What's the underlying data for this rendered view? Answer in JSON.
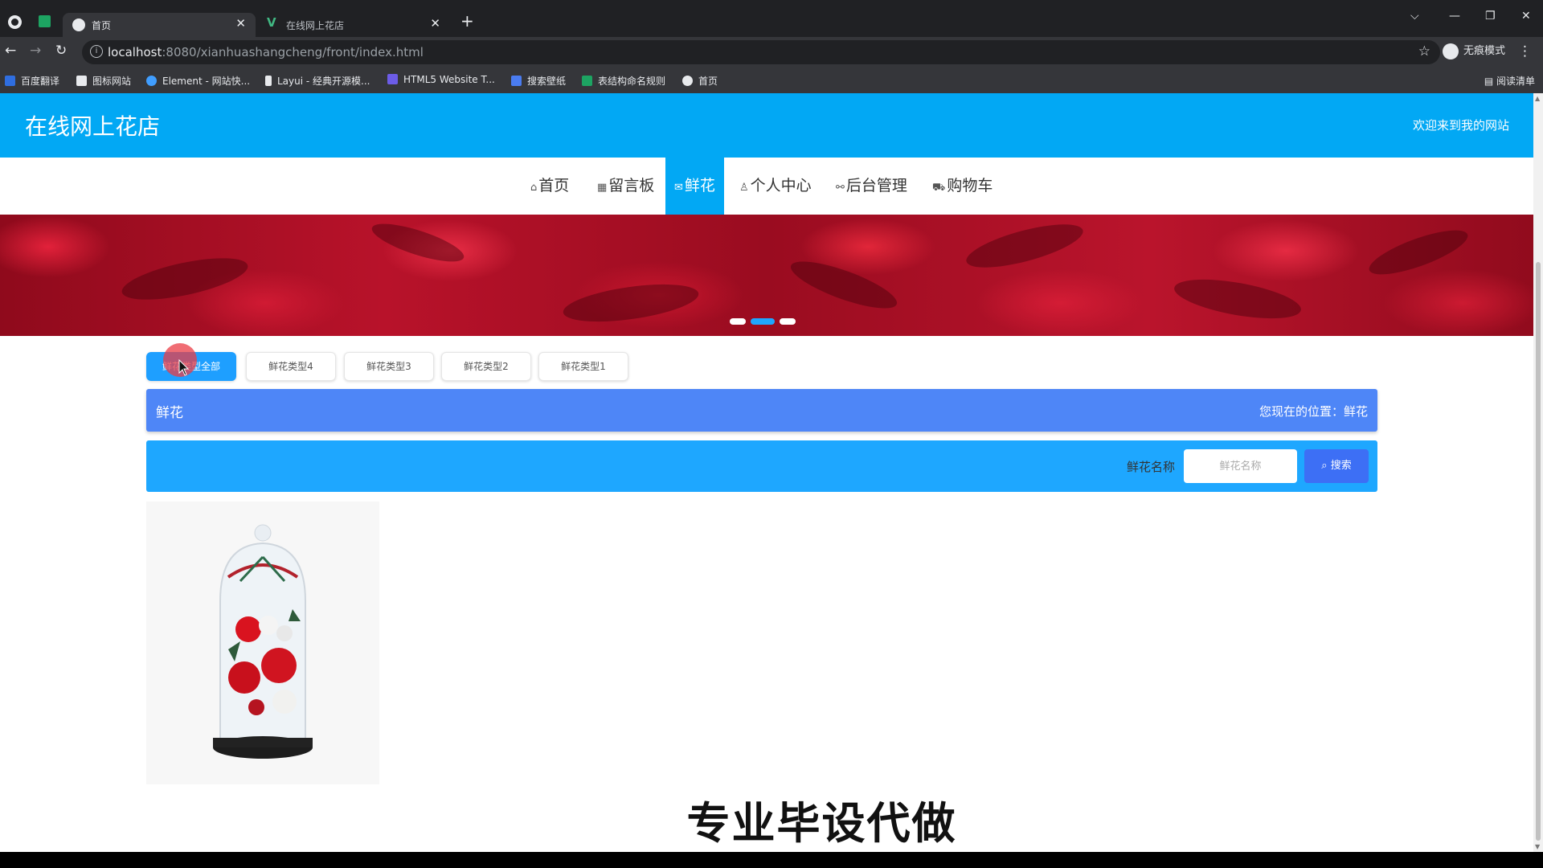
{
  "browser": {
    "tabs": [
      {
        "title": "首页",
        "active": true
      },
      {
        "title": "在线网上花店",
        "active": false
      }
    ],
    "url_host": "localhost",
    "url_rest": ":8080/xianhuashangcheng/front/index.html",
    "profile_label": "无痕模式",
    "bookmarks": [
      "百度翻译",
      "图标网站",
      "Element - 网站快...",
      "Layui - 经典开源模...",
      "HTML5 Website T...",
      "搜索壁纸",
      "表结构命名规则",
      "首页"
    ],
    "reading_list": "阅读清单"
  },
  "site": {
    "title": "在线网上花店",
    "welcome": "欢迎来到我的网站"
  },
  "nav": {
    "items": [
      {
        "label": "首页",
        "icon": "home-icon",
        "glyph": "⌂"
      },
      {
        "label": "留言板",
        "icon": "board-icon",
        "glyph": "▦"
      },
      {
        "label": "鲜花",
        "icon": "mail-icon",
        "glyph": "✉",
        "active": true
      },
      {
        "label": "个人中心",
        "icon": "user-icon",
        "glyph": "♙"
      },
      {
        "label": "后台管理",
        "icon": "link-icon",
        "glyph": "🔗"
      },
      {
        "label": "购物车",
        "icon": "cart-icon",
        "glyph": "🛒"
      }
    ]
  },
  "banner": {
    "active_dot": 1,
    "dot_count": 3
  },
  "types": [
    {
      "label": "鲜花类型全部",
      "active": true
    },
    {
      "label": "鲜花类型4"
    },
    {
      "label": "鲜花类型3"
    },
    {
      "label": "鲜花类型2"
    },
    {
      "label": "鲜花类型1"
    }
  ],
  "crumb": {
    "title": "鲜花",
    "location": "您现在的位置：鲜花"
  },
  "search": {
    "label": "鲜花名称",
    "placeholder": "鲜花名称",
    "button": "搜索"
  },
  "watermark": "专业毕设代做",
  "colors": {
    "header": "#02a8f4",
    "crumb": "#4e86f7",
    "search_bar": "#1ea7ff",
    "search_button": "#3d6ff5"
  }
}
